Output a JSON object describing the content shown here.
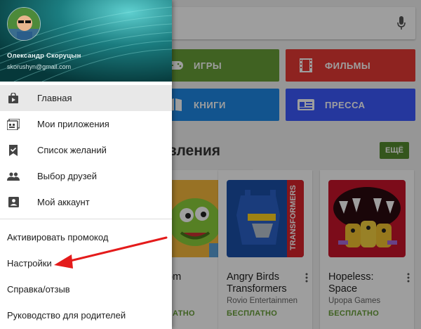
{
  "background": {
    "tiles": [
      {
        "label": "ИГРЫ",
        "icon": "gamepad-icon",
        "color": "#689f38"
      },
      {
        "label": "ФИЛЬМЫ",
        "icon": "film-icon",
        "color": "#e53935"
      },
      {
        "label": "КНИГИ",
        "icon": "book-icon",
        "color": "#1e88e5"
      },
      {
        "label": "ПРЕССА",
        "icon": "newspaper-icon",
        "color": "#3d5afe"
      }
    ],
    "section_title": "овления",
    "more_label": "ЕЩЁ",
    "cards": [
      {
        "title": "om",
        "developer": "",
        "price": "ЛАТНО"
      },
      {
        "title": "Angry Birds Transformers",
        "developer": "Rovio Entertainmen",
        "price": "БЕСПЛАТНО"
      },
      {
        "title": "Hopeless: Space",
        "developer": "Upopa Games",
        "price": "БЕСПЛАТНО"
      }
    ]
  },
  "drawer": {
    "account": {
      "name": "Олександр Скоруцын",
      "email": "skorushyn@gmail.com"
    },
    "nav_items": [
      {
        "label": "Главная",
        "icon": "store-bag-icon",
        "active": true
      },
      {
        "label": "Мои приложения",
        "icon": "my-apps-icon",
        "active": false
      },
      {
        "label": "Список желаний",
        "icon": "bookmark-icon",
        "active": false
      },
      {
        "label": "Выбор друзей",
        "icon": "people-icon",
        "active": false
      },
      {
        "label": "Мой аккаунт",
        "icon": "account-icon",
        "active": false
      }
    ],
    "secondary_items": [
      {
        "label": "Активировать промокод"
      },
      {
        "label": "Настройки"
      },
      {
        "label": "Справка/отзыв"
      },
      {
        "label": "Руководство для родителей"
      }
    ]
  },
  "colors": {
    "annotation_arrow": "#e41b1b",
    "free_price": "#689f38",
    "more_button": "#558b2f"
  }
}
